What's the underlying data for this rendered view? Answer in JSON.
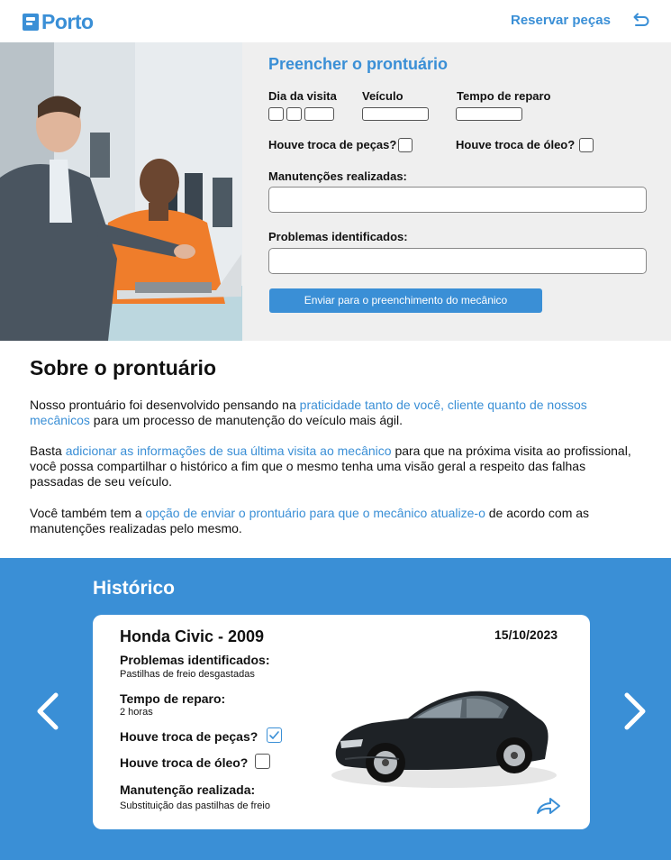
{
  "header": {
    "logo_text": "Porto",
    "reserve_link": "Reservar peças",
    "back_icon": "back-arrow-icon"
  },
  "form": {
    "title": "Preencher o prontuário",
    "visit_day_label": "Dia da visita",
    "vehicle_label": "Veículo",
    "repair_time_label": "Tempo de reparo",
    "parts_change_label": "Houve troca de peças?",
    "oil_change_label": "Houve troca de óleo?",
    "maintenance_label": "Manutenções realizadas:",
    "problems_label": "Problemas identificados:",
    "send_button": "Enviar para o preenchimento do mecânico"
  },
  "about": {
    "title": "Sobre o prontuário",
    "p1_a": "Nosso prontuário foi desenvolvido pensando na ",
    "p1_hl": "praticidade tanto de você, cliente quanto de nossos mecânicos",
    "p1_b": " para um processo de manutenção do veículo mais ágil.",
    "p2_a": "Basta ",
    "p2_hl": "adicionar as informações de sua última visita ao mecânico",
    "p2_b": " para que na próxima visita ao profissional, você possa compartilhar o histórico a fim que o mesmo tenha uma visão geral a respeito das falhas passadas de seu veículo.",
    "p3_a": "Você também tem a ",
    "p3_hl": "opção de enviar o prontuário para que o mecânico atualize-o",
    "p3_b": " de acordo com as manutenções realizadas pelo mesmo."
  },
  "history": {
    "title": "Histórico",
    "card": {
      "car": "Honda Civic - 2009",
      "date": "15/10/2023",
      "problems_label": "Problemas identificados:",
      "problems_value": "Pastilhas de freio desgastadas",
      "repair_time_label": "Tempo de reparo:",
      "repair_time_value": "2 horas",
      "parts_change_label": "Houve troca de peças?",
      "parts_change_checked": true,
      "oil_change_label": "Houve troca de óleo?",
      "oil_change_checked": false,
      "maintenance_label": "Manutenção realizada:",
      "maintenance_value": "Substituição das pastilhas de freio"
    }
  },
  "colors": {
    "brand": "#3a8fd6",
    "form_bg": "#efefef"
  }
}
